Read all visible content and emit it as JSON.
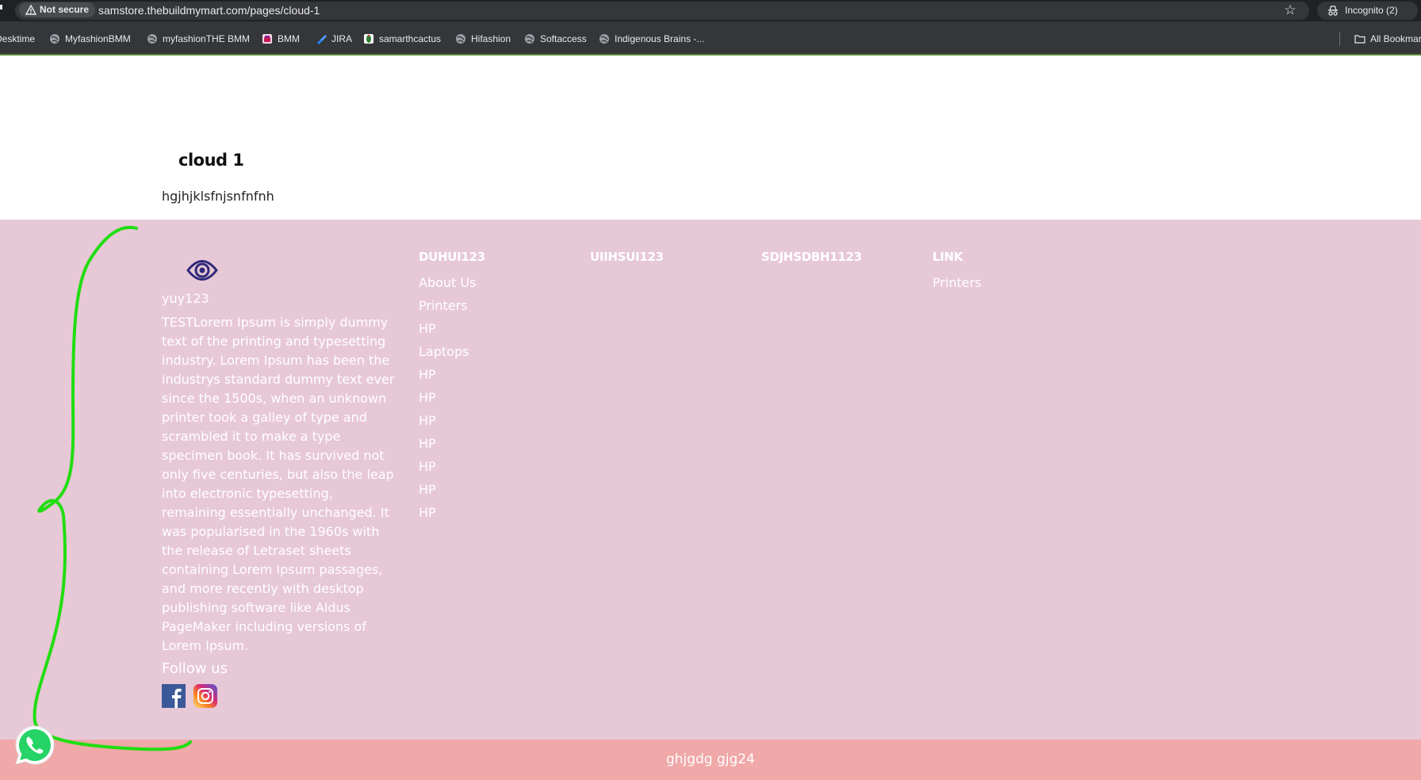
{
  "browser": {
    "security_label": "Not secure",
    "url": "samstore.thebuildmymart.com/pages/cloud-1",
    "incognito_label": "Incognito (2)",
    "bookmarks": [
      {
        "label": "Desktime"
      },
      {
        "label": "MyfashionBMM"
      },
      {
        "label": "myfashionTHE BMM"
      },
      {
        "label": "BMM"
      },
      {
        "label": "JIRA"
      },
      {
        "label": "samarthcactus"
      },
      {
        "label": "Hifashion"
      },
      {
        "label": "Softaccess"
      },
      {
        "label": "Indigenous Brains -..."
      }
    ],
    "all_bookmarks_label": "All Bookmarks"
  },
  "page": {
    "title": "cloud 1",
    "body": "hgjhjklsfnjsnfnfnh"
  },
  "footer": {
    "brand": "yuy123",
    "about": "TESTLorem Ipsum is simply dummy text of the printing and typesetting industry. Lorem Ipsum has been the industrys standard dummy text ever since the 1500s, when an unknown printer took a galley of type and scrambled it to make a type specimen book. It has survived not only five centuries, but also the leap into electronic typesetting, remaining essentially unchanged. It was popularised in the 1960s with the release of Letraset sheets containing Lorem Ipsum passages, and more recently with desktop publishing software like Aldus PageMaker including versions of Lorem Ipsum.",
    "follow_label": "Follow us",
    "columns": [
      {
        "heading": "DUHUI123",
        "links": [
          "About Us",
          "Printers",
          "HP",
          "Laptops",
          "HP",
          "HP",
          "HP",
          "HP",
          "HP",
          "HP",
          "HP"
        ]
      },
      {
        "heading": "UIIHSUI123",
        "links": []
      },
      {
        "heading": "SDJHSDBH1123",
        "links": []
      },
      {
        "heading": "LINK",
        "links": [
          "Printers"
        ]
      }
    ],
    "copyright": "ghjgdg gjg24"
  },
  "colors": {
    "footer_bg": "#e7c8d6",
    "copyright_bg": "#f0a8a8",
    "annotation_stroke": "#22dd11",
    "whatsapp_green": "#25d366"
  },
  "icons": [
    "warning-icon",
    "star-icon",
    "incognito-icon",
    "globe-icon",
    "folder-icon",
    "logo-icon",
    "facebook-icon",
    "instagram-icon",
    "whatsapp-icon"
  ]
}
